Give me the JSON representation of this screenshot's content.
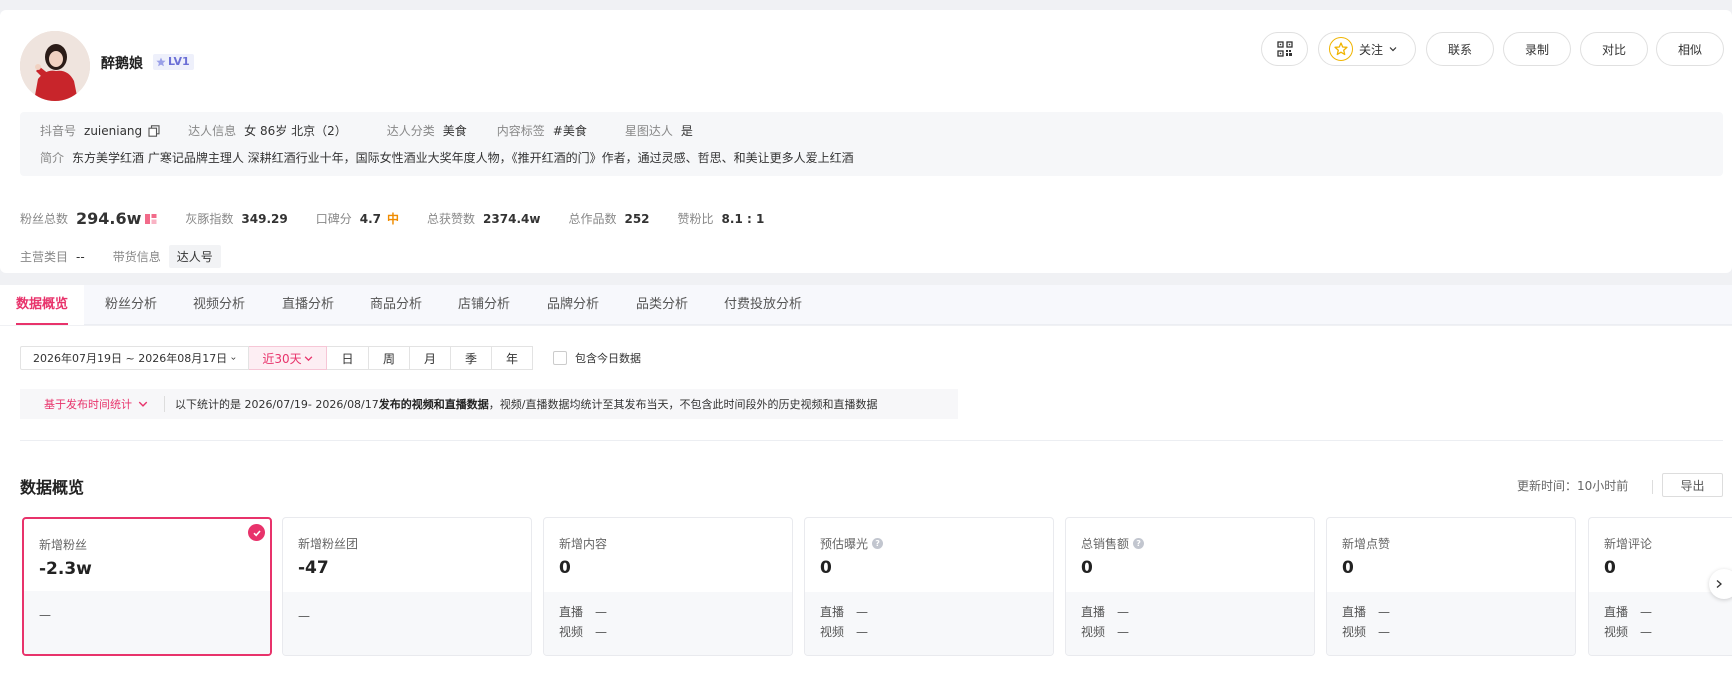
{
  "profile": {
    "name": "醉鹅娘",
    "level": "LV1",
    "actions": {
      "follow": "关注",
      "contact": "联系",
      "record": "录制",
      "compare": "对比",
      "similar": "相似"
    },
    "info": {
      "douyin_label": "抖音号",
      "douyin_value": "zuieniang",
      "talent_info_label": "达人信息",
      "talent_info_value": "女 86岁 北京（2）",
      "category_label": "达人分类",
      "category_value": "美食",
      "content_tag_label": "内容标签",
      "content_tag_value": "#美食",
      "star_label": "星图达人",
      "star_value": "是",
      "intro_label": "简介",
      "intro_value": "东方美学红酒 广寒记品牌主理人 深耕红酒行业十年，国际女性酒业大奖年度人物，《推开红酒的门》作者，通过灵感、哲思、和美让更多人爱上红酒"
    },
    "stats": {
      "fans_label": "粉丝总数",
      "fans_value": "294.6w",
      "gray_label": "灰豚指数",
      "gray_value": "349.29",
      "reputation_label": "口碑分",
      "reputation_value": "4.7",
      "reputation_grade": "中",
      "likes_label": "总获赞数",
      "likes_value": "2374.4w",
      "works_label": "总作品数",
      "works_value": "252",
      "ratio_label": "赞粉比",
      "ratio_value": "8.1 : 1"
    },
    "categories": {
      "main_label": "主营类目",
      "main_value": "--",
      "goods_label": "带货信息",
      "goods_value": "达人号"
    }
  },
  "tabs": [
    "数据概览",
    "粉丝分析",
    "视频分析",
    "直播分析",
    "商品分析",
    "店铺分析",
    "品牌分析",
    "品类分析",
    "付费投放分析"
  ],
  "filters": {
    "date_range": "2026年07月19日 ~ 2026年08月17日",
    "periods": [
      "近30天",
      "日",
      "周",
      "月",
      "季",
      "年"
    ],
    "include_today": "包含今日数据"
  },
  "notice": {
    "select": "基于发布时间统计",
    "prefix": "以下统计的是 2026/07/19- 2026/08/17 ",
    "bold": "发布的视频和直播数据",
    "suffix": "，视频/直播数据均统计至其发布当天，不包含此时间段外的历史视频和直播数据"
  },
  "overview": {
    "title": "数据概览",
    "update_time": "更新时间：10小时前",
    "export": "导出",
    "cards": [
      {
        "label": "新增粉丝",
        "value": "-2.3w",
        "sub": "—"
      },
      {
        "label": "新增粉丝团",
        "value": "-47",
        "sub": "—"
      },
      {
        "label": "新增内容",
        "value": "0",
        "live_label": "直播",
        "live_value": "—",
        "video_label": "视频",
        "video_value": "—"
      },
      {
        "label": "预估曝光",
        "value": "0",
        "live_label": "直播",
        "live_value": "—",
        "video_label": "视频",
        "video_value": "—"
      },
      {
        "label": "总销售额",
        "value": "0",
        "live_label": "直播",
        "live_value": "—",
        "video_label": "视频",
        "video_value": "—"
      },
      {
        "label": "新增点赞",
        "value": "0",
        "live_label": "直播",
        "live_value": "—",
        "video_label": "视频",
        "video_value": "—"
      },
      {
        "label": "新增评论",
        "value": "0",
        "live_label": "直播",
        "live_value": "—",
        "video_label": "视频",
        "video_value": "—"
      }
    ]
  },
  "colors": {
    "accent": "#e8336b",
    "star": "#f0b400",
    "grade": "#f08c00"
  }
}
